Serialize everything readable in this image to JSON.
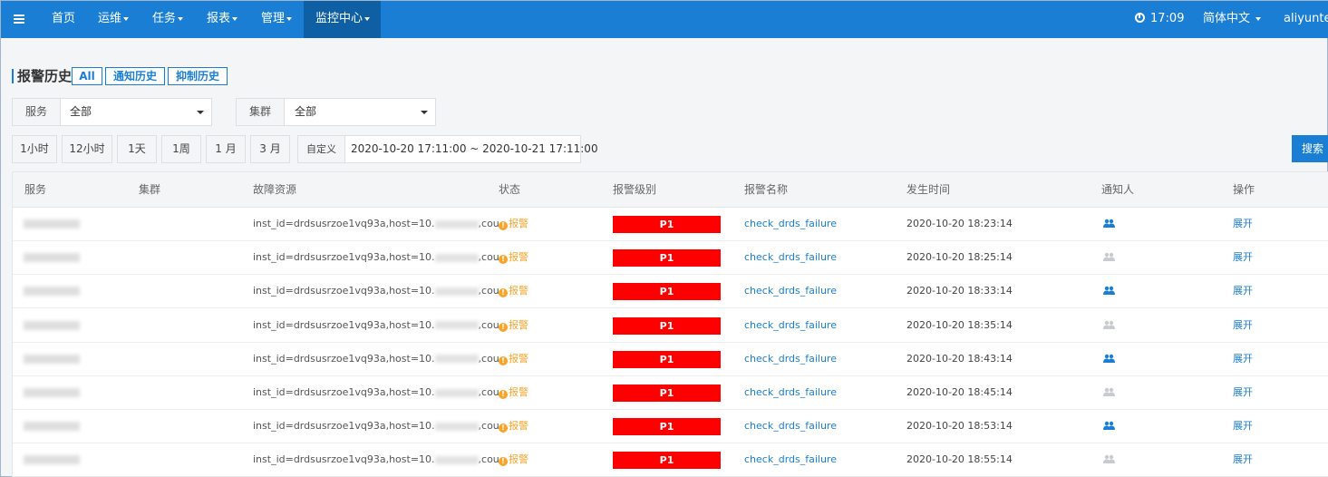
{
  "topbar": {
    "menu_icon": "menu-icon",
    "nav": [
      {
        "label": "首页",
        "dropdown": false,
        "active": false
      },
      {
        "label": "运维",
        "dropdown": true,
        "active": false
      },
      {
        "label": "任务",
        "dropdown": true,
        "active": false
      },
      {
        "label": "报表",
        "dropdown": true,
        "active": false
      },
      {
        "label": "管理",
        "dropdown": true,
        "active": false
      },
      {
        "label": "监控中心",
        "dropdown": true,
        "active": true
      }
    ],
    "time": "17:09",
    "clock_icon": "clock-icon",
    "language": "简体中文",
    "user": "aliyuntes"
  },
  "page": {
    "title": "报警历史",
    "tabs": [
      "All",
      "通知历史",
      "抑制历史"
    ]
  },
  "filters": {
    "service_label": "服务",
    "service_value": "全部",
    "cluster_label": "集群",
    "cluster_value": "全部"
  },
  "time_range": {
    "buttons": [
      "1小时",
      "12小时",
      "1天",
      "1周",
      "1 月",
      "3 月",
      "自定义"
    ],
    "range": "2020-10-20 17:11:00 ~ 2020-10-21 17:11:00",
    "search_label": "搜索"
  },
  "table": {
    "columns": [
      "服务",
      "集群",
      "故障资源",
      "状态",
      "报警级别",
      "报警名称",
      "发生时间",
      "通知人",
      "操作"
    ],
    "rows": [
      {
        "resource_prefix": "inst_id=drdsusrzoe1vq93a,host=10.",
        "resource_suffix": ",cou...",
        "status": "报警",
        "level": "P1",
        "name": "check_drds_failure",
        "time": "2020-10-20 18:23:14",
        "notify_active": true,
        "action": "展开"
      },
      {
        "resource_prefix": "inst_id=drdsusrzoe1vq93a,host=10.",
        "resource_suffix": ",cou...",
        "status": "报警",
        "level": "P1",
        "name": "check_drds_failure",
        "time": "2020-10-20 18:25:14",
        "notify_active": false,
        "action": "展开"
      },
      {
        "resource_prefix": "inst_id=drdsusrzoe1vq93a,host=10.",
        "resource_suffix": ",cou...",
        "status": "报警",
        "level": "P1",
        "name": "check_drds_failure",
        "time": "2020-10-20 18:33:14",
        "notify_active": true,
        "action": "展开"
      },
      {
        "resource_prefix": "inst_id=drdsusrzoe1vq93a,host=10.",
        "resource_suffix": ",cou...",
        "status": "报警",
        "level": "P1",
        "name": "check_drds_failure",
        "time": "2020-10-20 18:35:14",
        "notify_active": false,
        "action": "展开"
      },
      {
        "resource_prefix": "inst_id=drdsusrzoe1vq93a,host=10.",
        "resource_suffix": ",cou...",
        "status": "报警",
        "level": "P1",
        "name": "check_drds_failure",
        "time": "2020-10-20 18:43:14",
        "notify_active": true,
        "action": "展开"
      },
      {
        "resource_prefix": "inst_id=drdsusrzoe1vq93a,host=10.",
        "resource_suffix": ",cou...",
        "status": "报警",
        "level": "P1",
        "name": "check_drds_failure",
        "time": "2020-10-20 18:45:14",
        "notify_active": false,
        "action": "展开"
      },
      {
        "resource_prefix": "inst_id=drdsusrzoe1vq93a,host=10.",
        "resource_suffix": ",cou...",
        "status": "报警",
        "level": "P1",
        "name": "check_drds_failure",
        "time": "2020-10-20 18:53:14",
        "notify_active": true,
        "action": "展开"
      },
      {
        "resource_prefix": "inst_id=drdsusrzoe1vq93a,host=10.",
        "resource_suffix": ",cou...",
        "status": "报警",
        "level": "P1",
        "name": "check_drds_failure",
        "time": "2020-10-20 18:55:14",
        "notify_active": false,
        "action": "展开"
      }
    ]
  },
  "colors": {
    "primary": "#1a7fd4",
    "nav_active": "#0e5fa3",
    "level_p1": "#ff0000",
    "status_warning": "#f7a52b"
  },
  "icons": {
    "status": "warning-icon",
    "notify": "users-icon",
    "dropdown": "chevron-down-icon"
  }
}
